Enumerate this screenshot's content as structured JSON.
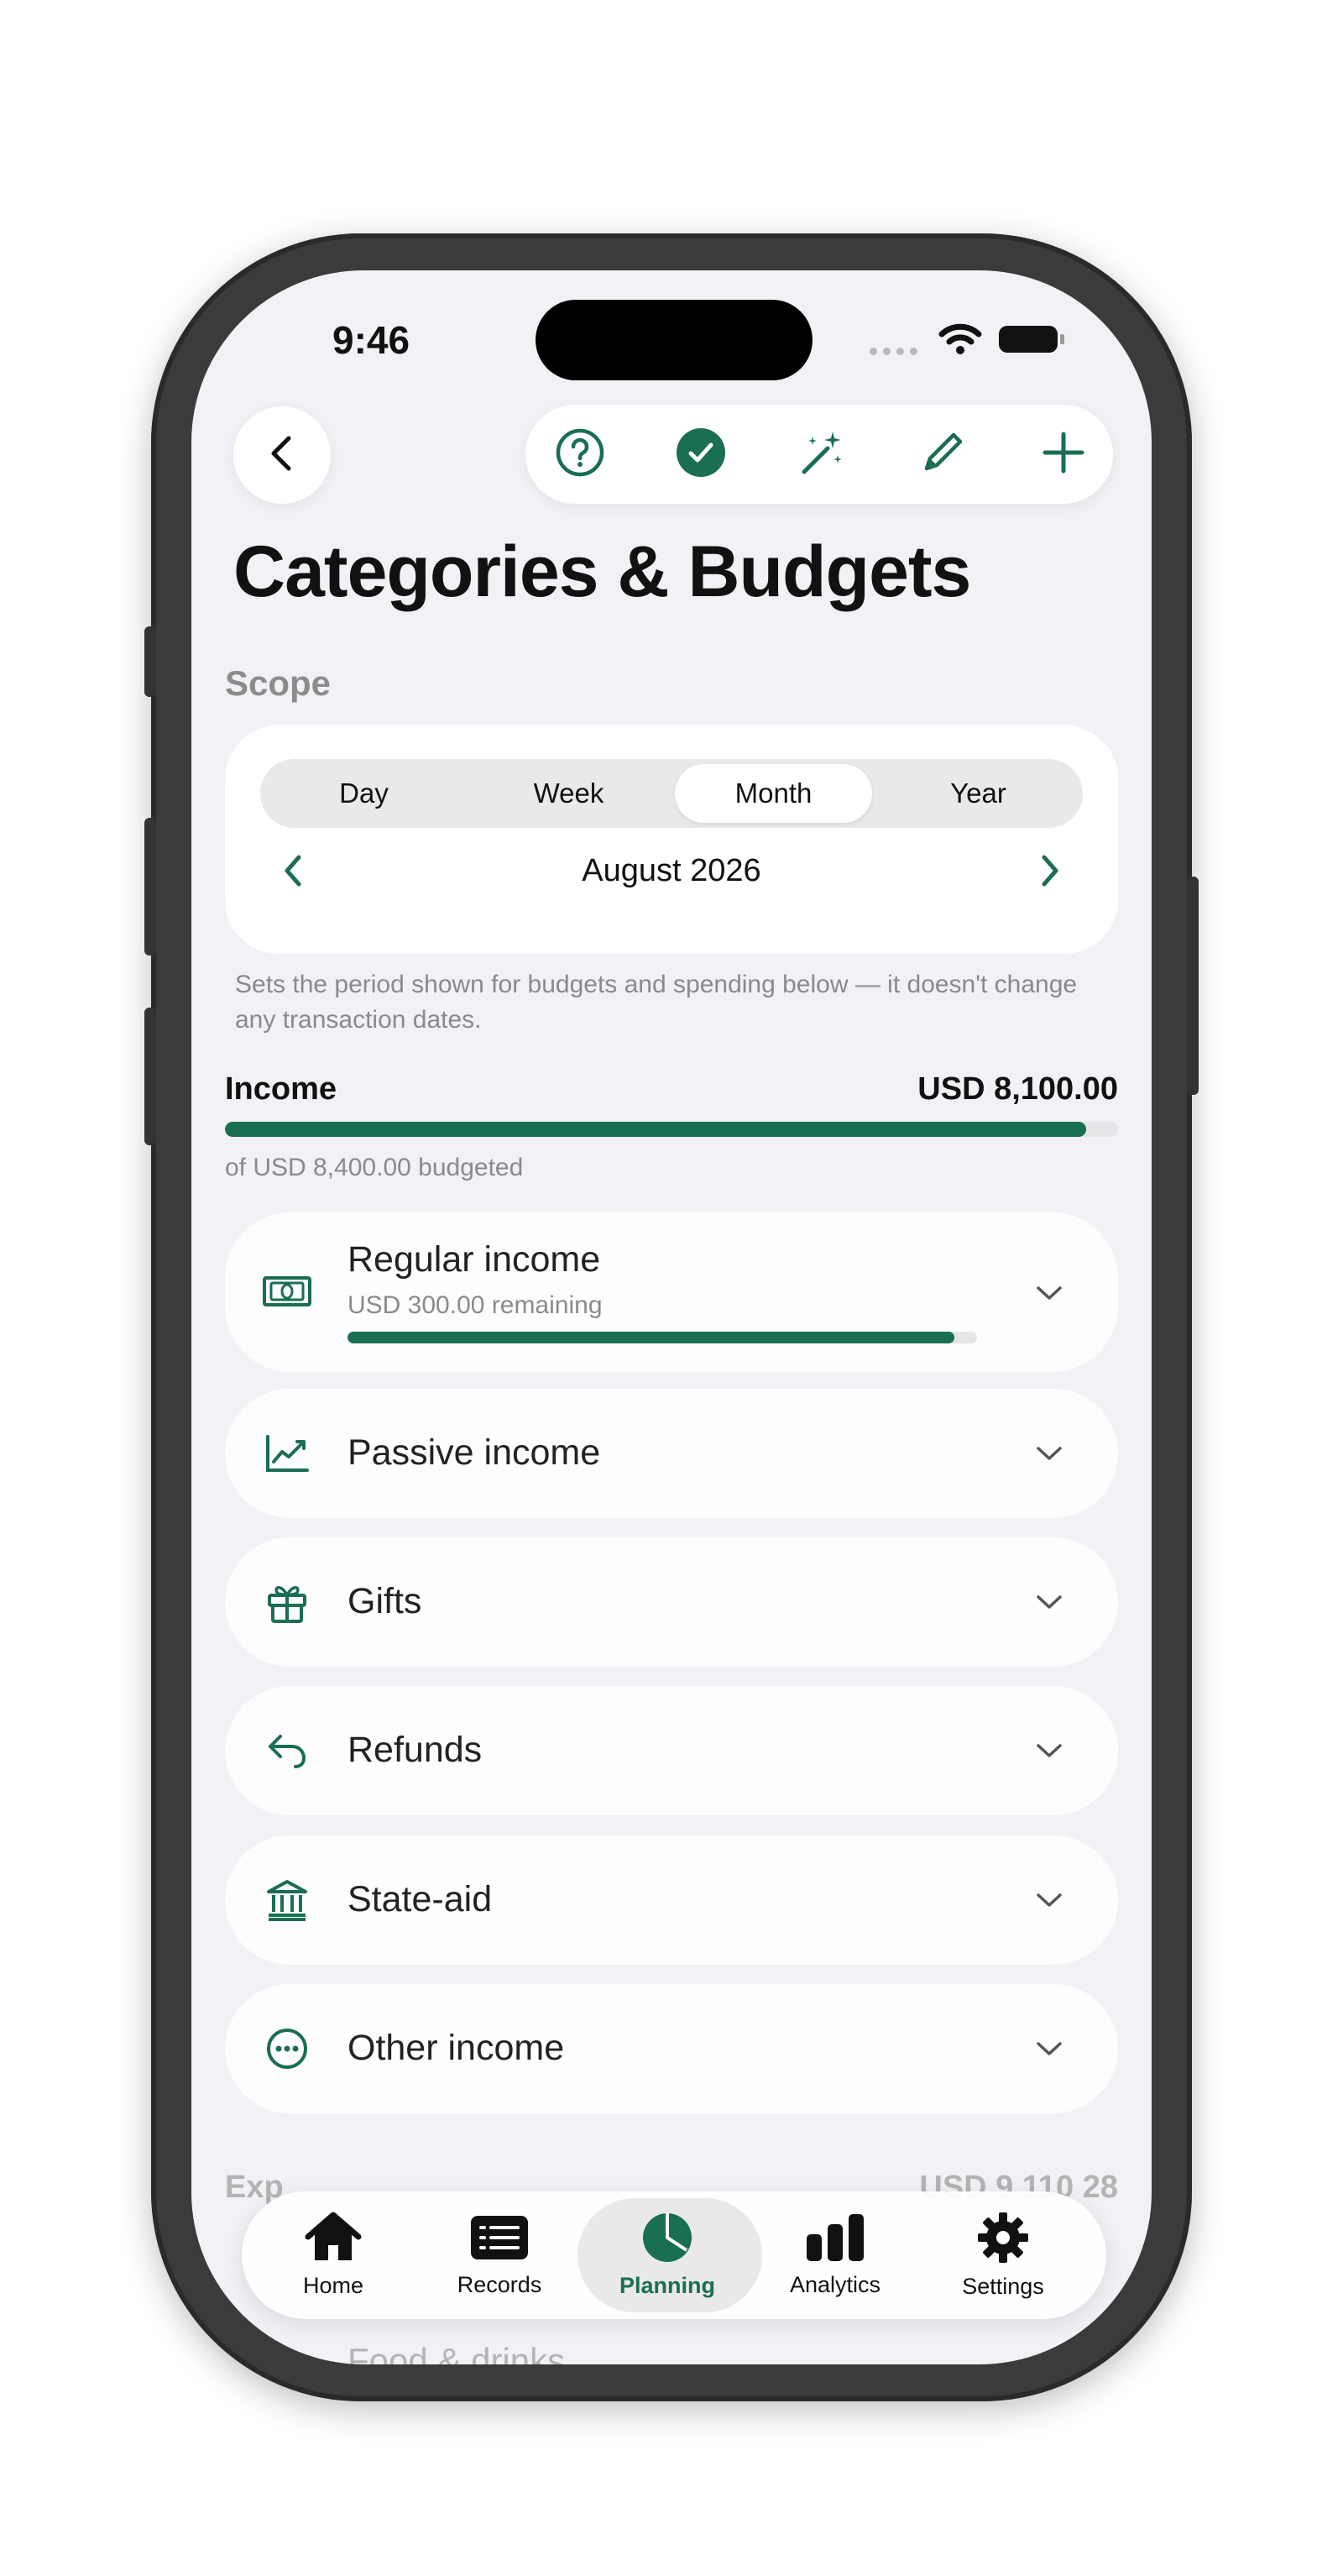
{
  "status_bar": {
    "time": "9:46"
  },
  "toolbar": {
    "icons": [
      "help-icon",
      "checkmark-circle-icon",
      "magic-wand-icon",
      "pencil-icon",
      "plus-icon"
    ]
  },
  "page": {
    "title": "Categories & Budgets"
  },
  "scope": {
    "label": "Scope",
    "segments": [
      "Day",
      "Week",
      "Month",
      "Year"
    ],
    "selected": "Month",
    "period": "August 2026",
    "hint": "Sets the period shown for budgets and spending below — it doesn't change any transaction dates."
  },
  "income": {
    "label": "Income",
    "amount": "USD 8,100.00",
    "budgeted": "of USD 8,400.00 budgeted",
    "progress": 0.964,
    "categories": [
      {
        "name": "Regular income",
        "remaining": "USD 300.00 remaining",
        "progress": 0.964,
        "icon": "banknote-icon"
      },
      {
        "name": "Passive income",
        "icon": "chart-line-icon"
      },
      {
        "name": "Gifts",
        "icon": "gift-icon"
      },
      {
        "name": "Refunds",
        "icon": "return-arrow-icon"
      },
      {
        "name": "State-aid",
        "icon": "bank-icon"
      },
      {
        "name": "Other income",
        "icon": "ellipsis-circle-icon"
      }
    ]
  },
  "expenses": {
    "label": "Exp",
    "amount": "USD 9 110 28",
    "first_category": "Food & drinks"
  },
  "tabbar": {
    "tabs": [
      {
        "label": "Home",
        "icon": "house-icon"
      },
      {
        "label": "Records",
        "icon": "list-icon"
      },
      {
        "label": "Planning",
        "icon": "pie-chart-icon"
      },
      {
        "label": "Analytics",
        "icon": "bar-chart-icon"
      },
      {
        "label": "Settings",
        "icon": "gear-icon"
      }
    ],
    "active": "Planning"
  },
  "colors": {
    "accent": "#1a6e52",
    "background": "#f2f2f6"
  }
}
